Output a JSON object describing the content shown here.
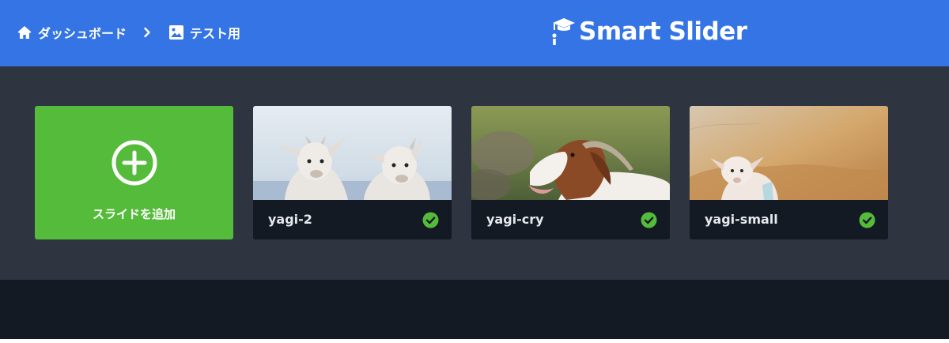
{
  "header": {
    "breadcrumb": [
      {
        "label": "ダッシュボード",
        "icon": "home-icon"
      },
      {
        "label": "テスト用",
        "icon": "image-icon"
      }
    ],
    "separator_icon": "chevron-right-icon",
    "brand": {
      "name": "Smart Slider",
      "icon": "mortarboard-icon"
    }
  },
  "slides_panel": {
    "add_slide_label": "スライドを追加",
    "add_icon": "plus-circle-icon",
    "slides": [
      {
        "name": "yagi-2",
        "status_icon": "published-check-icon",
        "thumbnail": "two white mountain goat kids against sky"
      },
      {
        "name": "yagi-cry",
        "status_icon": "published-check-icon",
        "thumbnail": "brown and white goat bleating on grass"
      },
      {
        "name": "yagi-small",
        "status_icon": "published-check-icon",
        "thumbnail": "small white lamb in golden grass"
      }
    ]
  },
  "colors": {
    "header_bg": "#3574e4",
    "panel_bg": "#2e3540",
    "footer_bg": "#131a23",
    "add_card_bg": "#55bb3b",
    "check_green": "#55bb3b"
  }
}
